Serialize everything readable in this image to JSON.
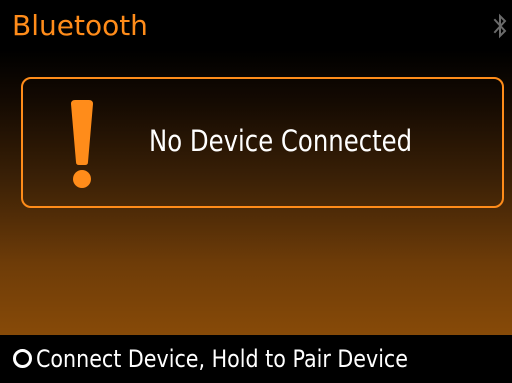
{
  "header": {
    "title": "Bluetooth",
    "status_icon": "bluetooth-icon"
  },
  "alert": {
    "icon": "exclamation-icon",
    "message": "No Device Connected"
  },
  "footer": {
    "button_icon": "circle-button-icon",
    "hint": "Connect  Device, Hold to Pair Device"
  },
  "colors": {
    "accent": "#ff8c1a",
    "text": "#ffffff",
    "background": "#000000",
    "gradient_bottom": "#874a08"
  }
}
